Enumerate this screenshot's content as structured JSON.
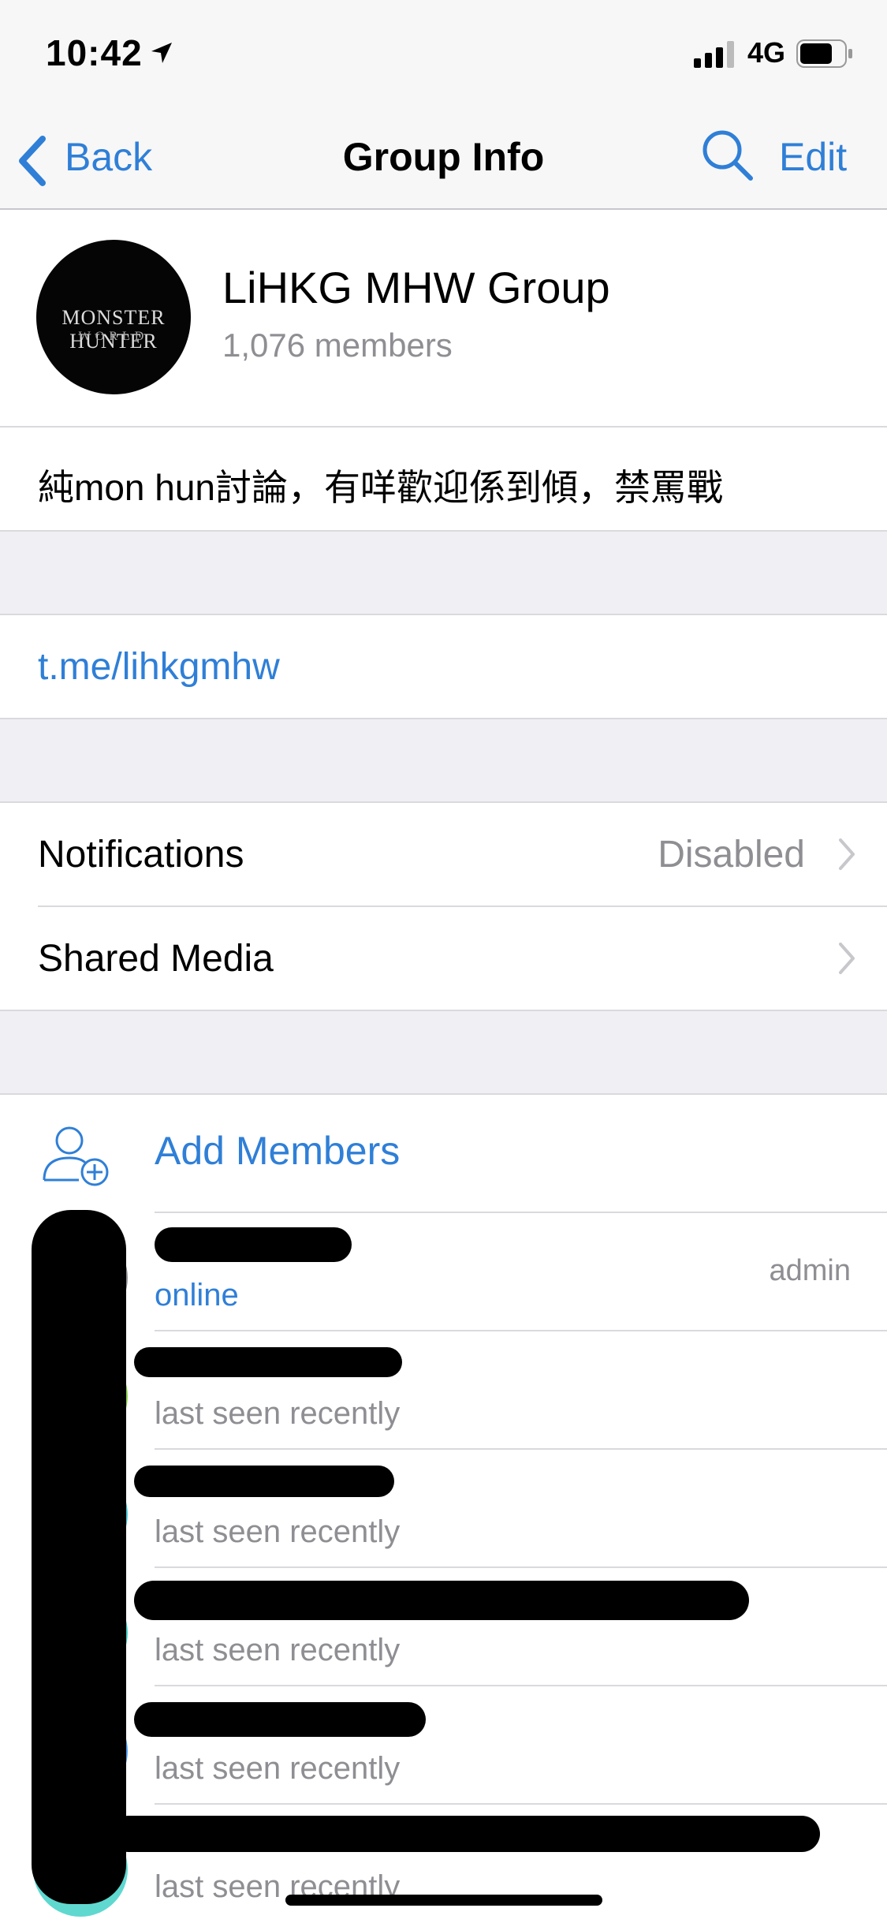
{
  "status_bar": {
    "time": "10:42",
    "network": "4G",
    "icons": [
      "location-arrow-icon",
      "signal-icon",
      "battery-icon"
    ]
  },
  "nav": {
    "back_label": "Back",
    "title": "Group Info",
    "edit_label": "Edit"
  },
  "group": {
    "avatar_text": "MONSTER HUNTER",
    "avatar_subtext": "WORLD",
    "name": "LiHKG MHW Group",
    "members": "1,076 members",
    "about": "純mon hun討論，有咩歡迎係到傾，禁罵戰",
    "link": "t.me/lihkgmhw"
  },
  "settings": {
    "notifications_label": "Notifications",
    "notifications_value": "Disabled",
    "shared_media_label": "Shared Media"
  },
  "members_section": {
    "add_members_label": "Add Members",
    "list": [
      {
        "status": "online",
        "role": "admin",
        "avatar_color": "#8e8e93"
      },
      {
        "status": "last seen recently",
        "role": "",
        "avatar_color": "#8bd14a"
      },
      {
        "status": "last seen recently",
        "role": "",
        "avatar_color": "#45c8d8"
      },
      {
        "status": "last seen recently",
        "role": "",
        "avatar_color": "#3fd0c4"
      },
      {
        "status": "last seen recently",
        "role": "",
        "avatar_color": "#4a9cf0"
      },
      {
        "status": "last seen recently",
        "role": "",
        "avatar_color": "#5fd8d0"
      }
    ]
  },
  "colors": {
    "accent": "#2f7fd7",
    "secondary_text": "#8e8e93",
    "group_bg": "#efeff4"
  }
}
